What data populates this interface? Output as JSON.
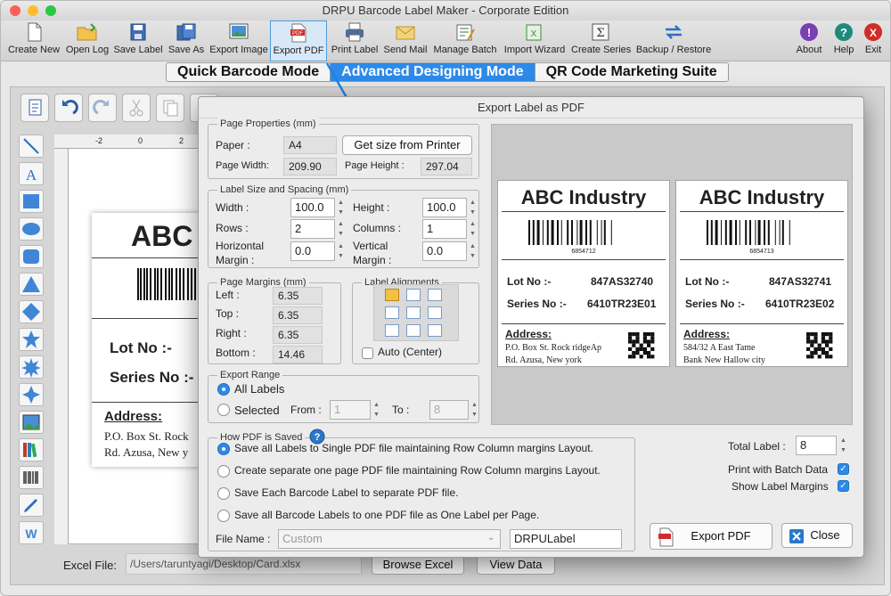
{
  "window": {
    "title": "DRPU Barcode Label Maker - Corporate Edition"
  },
  "toolbar": [
    {
      "label": "Create New",
      "icon": "new-file-icon"
    },
    {
      "label": "Open Log",
      "icon": "folder-open-icon"
    },
    {
      "label": "Save Label",
      "icon": "save-icon"
    },
    {
      "label": "Save As",
      "icon": "save-as-icon"
    },
    {
      "label": "Export Image",
      "icon": "export-image-icon"
    },
    {
      "label": "Export PDF",
      "icon": "pdf-icon"
    },
    {
      "label": "Print Label",
      "icon": "printer-icon"
    },
    {
      "label": "Send Mail",
      "icon": "mail-icon"
    },
    {
      "label": "Manage Batch",
      "icon": "batch-icon"
    },
    {
      "label": "Import Wizard",
      "icon": "import-wizard-icon"
    },
    {
      "label": "Create Series",
      "icon": "sigma-icon"
    },
    {
      "label": "Backup / Restore",
      "icon": "backup-icon"
    },
    {
      "label": "About",
      "icon": "about-icon"
    },
    {
      "label": "Help",
      "icon": "help-icon"
    },
    {
      "label": "Exit",
      "icon": "exit-icon"
    }
  ],
  "modes": {
    "quick": "Quick Barcode Mode",
    "advanced": "Advanced Designing Mode",
    "qr": "QR Code Marketing Suite"
  },
  "background_label": {
    "title": "ABC I",
    "lot": "Lot No :-",
    "series": "Series No :-",
    "address_label": "Address:",
    "address1": "P.O. Box St. Rock",
    "address2": "Rd. Azusa, New y"
  },
  "ruler": {
    "minus2": "-2",
    "zero": "0",
    "two": "2"
  },
  "excel": {
    "label": "Excel File:",
    "path": "/Users/taruntyagi/Desktop/Card.xlsx",
    "browse": "Browse Excel",
    "view": "View Data"
  },
  "dialog": {
    "title": "Export Label as PDF",
    "page_properties": {
      "title": "Page Properties (mm)",
      "paper_label": "Paper :",
      "paper": "A4",
      "get_size": "Get size from Printer",
      "width_label": "Page Width:",
      "width": "209.90",
      "height_label": "Page Height :",
      "height": "297.04"
    },
    "label_size": {
      "title": "Label Size and Spacing (mm)",
      "width_label": "Width :",
      "width": "100.0",
      "height_label": "Height :",
      "height": "100.0",
      "rows_label": "Rows :",
      "rows": "2",
      "columns_label": "Columns :",
      "columns": "1",
      "hmargin_label1": "Horizontal",
      "hmargin_label2": "Margin :",
      "hmargin": "0.0",
      "vmargin_label1": "Vertical",
      "vmargin_label2": "Margin :",
      "vmargin": "0.0"
    },
    "page_margins": {
      "title": "Page Margins (mm)",
      "left_label": "Left :",
      "left": "6.35",
      "top_label": "Top :",
      "top": "6.35",
      "right_label": "Right :",
      "right": "6.35",
      "bottom_label": "Bottom :",
      "bottom": "14.46"
    },
    "alignments": {
      "title": "Label Alignments",
      "auto": "Auto (Center)"
    },
    "export_range": {
      "title": "Export Range",
      "all": "All Labels",
      "selected": "Selected",
      "from_label": "From :",
      "from": "1",
      "to_label": "To :",
      "to": "8"
    },
    "how_saved": {
      "title": "How PDF is Saved",
      "opt1": "Save all Labels to Single PDF file maintaining Row Column margins Layout.",
      "opt2": "Create separate one page PDF file maintaining Row Column margins Layout.",
      "opt3": "Save Each Barcode Label to separate PDF file.",
      "opt4": "Save all Barcode Labels to one PDF file as One Label per Page.",
      "file_name_label": "File Name :",
      "file_name_mode": "Custom",
      "file_name": "DRPULabel"
    },
    "total_label": "Total Label :",
    "total": "8",
    "print_batch": "Print with Batch Data",
    "show_margins": "Show Label Margins",
    "export_btn": "Export PDF",
    "close_btn": "Close",
    "preview": [
      {
        "title": "ABC Industry",
        "barcode_num": "6854712",
        "lot_label": "Lot No :-",
        "lot": "847AS32740",
        "series_label": "Series No :-",
        "series": "6410TR23E01",
        "address_label": "Address:",
        "address1": "P.O. Box St. Rock ridgeAp",
        "address2": "Rd. Azusa, New york"
      },
      {
        "title": "ABC Industry",
        "barcode_num": "6854713",
        "lot_label": "Lot No :-",
        "lot": "847AS32741",
        "series_label": "Series No :-",
        "series": "6410TR23E02",
        "address_label": "Address:",
        "address1": "584/32 A East Tame",
        "address2": "Bank New Hallow city"
      }
    ]
  }
}
